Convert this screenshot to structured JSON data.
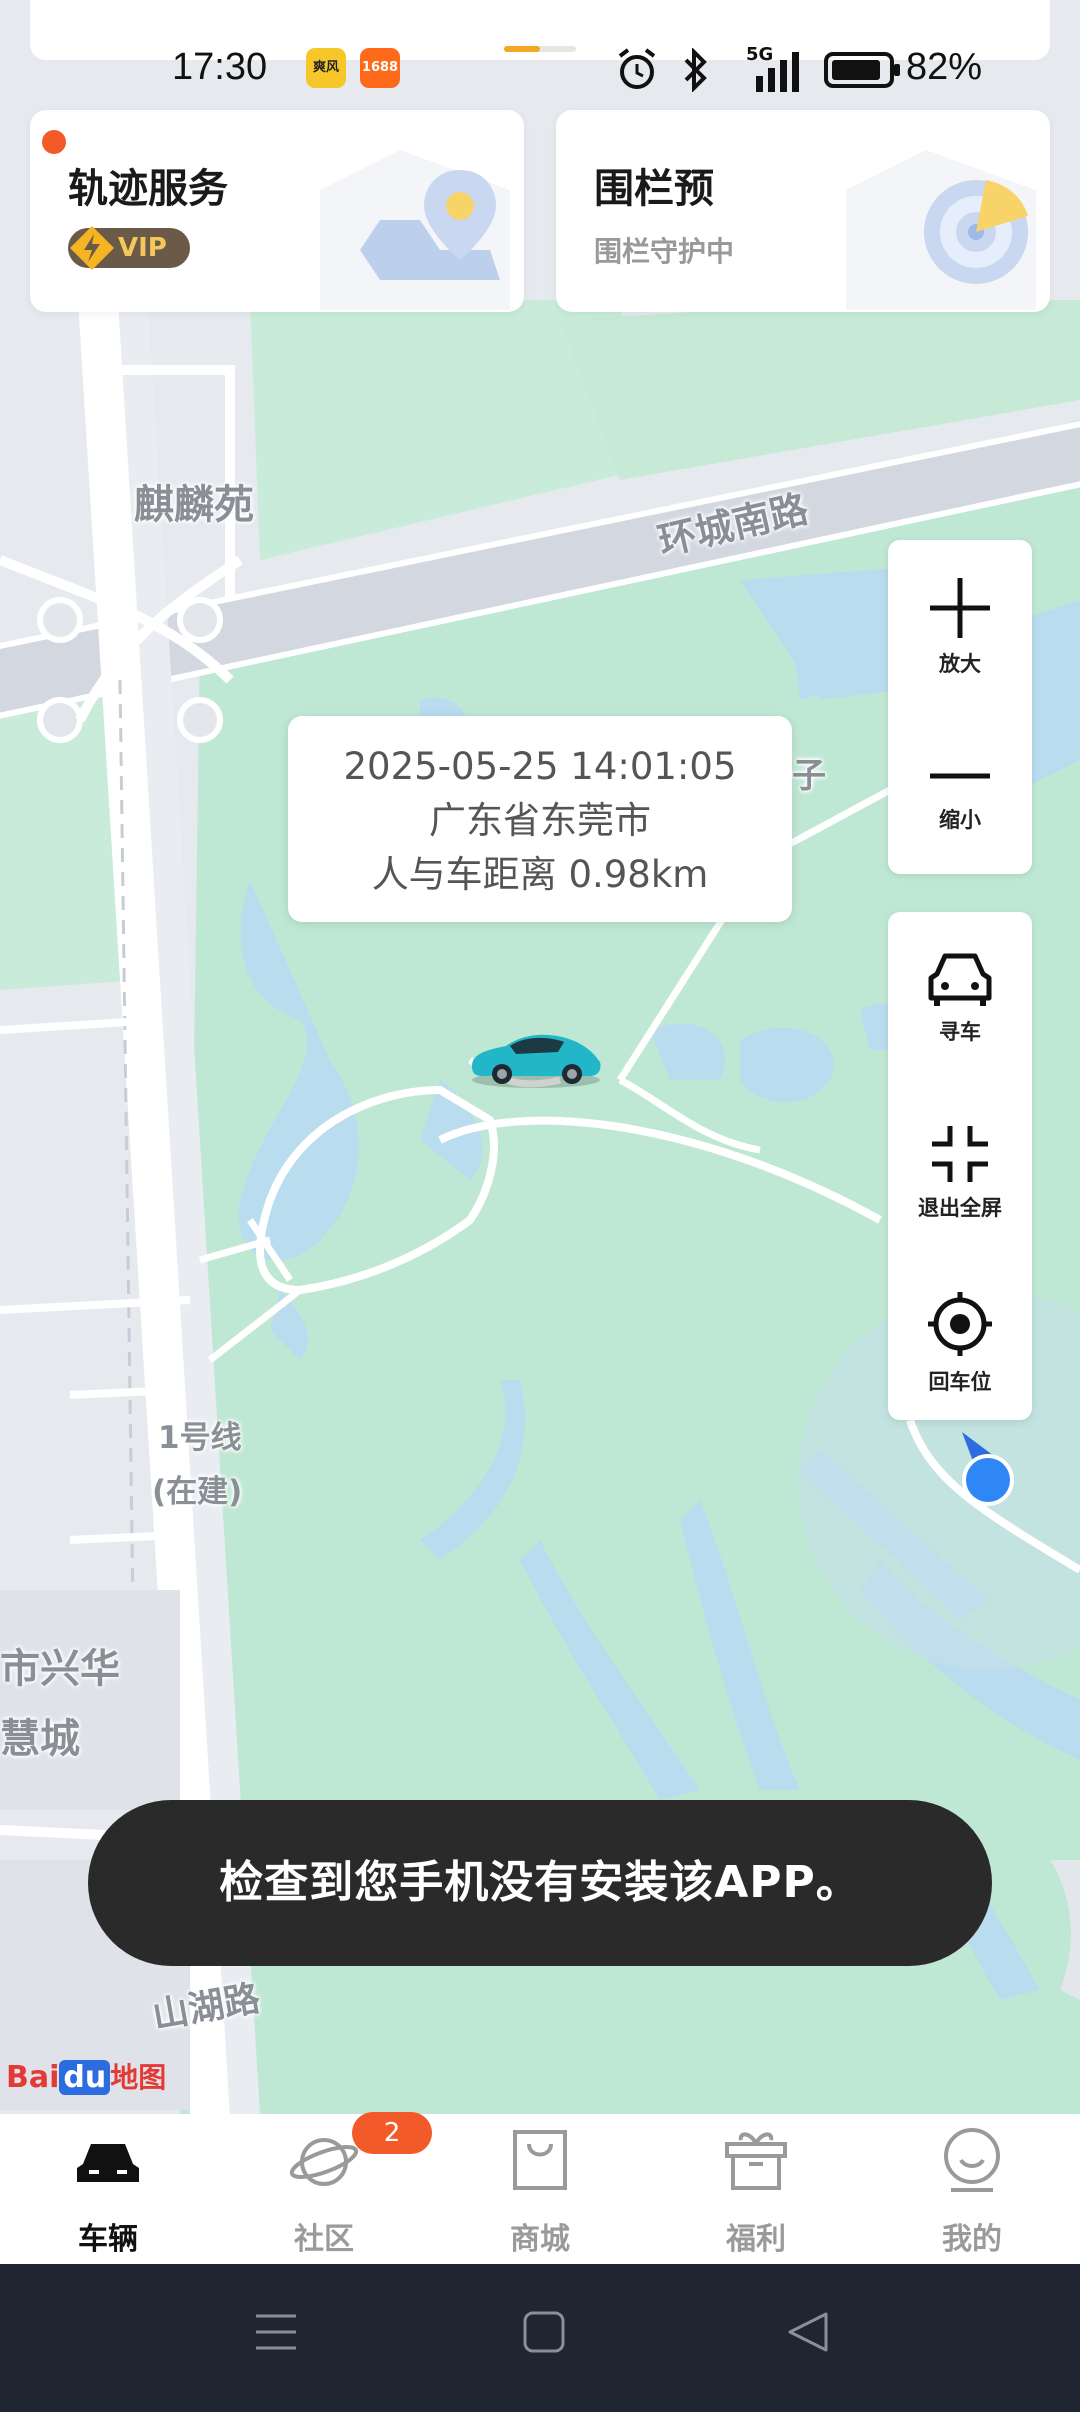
{
  "status_bar": {
    "time": "17:30",
    "apps": [
      "爽风",
      "1688"
    ],
    "network": "5G",
    "battery": "82%"
  },
  "cards": {
    "track": {
      "title": "轨迹服务",
      "badge": "VIP",
      "has_notification_dot": true
    },
    "fence": {
      "title": "围栏预",
      "subtitle": "围栏守护中"
    }
  },
  "map": {
    "labels": {
      "qilinyuan": "麒麟苑",
      "huancheng": "环城南路",
      "zi": "子",
      "line1": "1号线",
      "line1_sub": "(在建)",
      "xinghua": "市兴华",
      "huicheng": "慧城",
      "shanhu": "山湖路"
    },
    "logo": "Baidu地图"
  },
  "info_bubble": {
    "datetime": "2025-05-25 14:01:05",
    "location": "广东省东莞市",
    "distance": "人与车距离 0.98km"
  },
  "controls": {
    "zoom_in": "放大",
    "zoom_out": "缩小",
    "find_car": "寻车",
    "exit_fullscreen": "退出全屏",
    "back_to_car": "回车位"
  },
  "toast": "检查到您手机没有安装该APP。",
  "tabs": [
    {
      "label": "车辆",
      "icon": "car-icon",
      "active": true
    },
    {
      "label": "社区",
      "icon": "planet-icon",
      "badge": "2"
    },
    {
      "label": "商城",
      "icon": "bag-icon"
    },
    {
      "label": "福利",
      "icon": "gift-icon"
    },
    {
      "label": "我的",
      "icon": "profile-icon"
    }
  ],
  "colors": {
    "accent": "#f25a2a",
    "park_green": "#bfe8d4",
    "water": "#b9dcef",
    "toast_bg": "#2a2a2a",
    "nav_bg": "#1f2531"
  }
}
